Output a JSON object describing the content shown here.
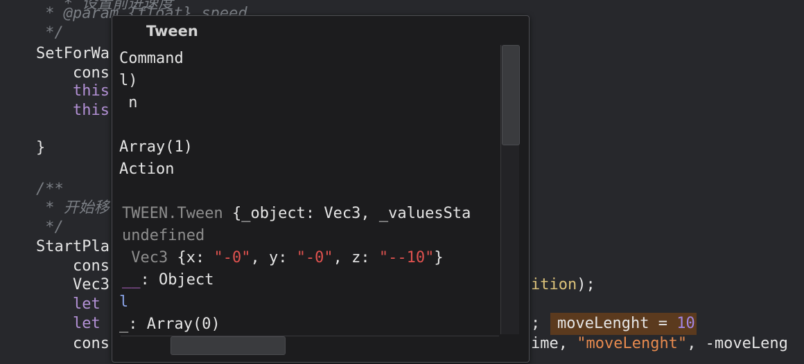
{
  "editor": {
    "lines": [
      {
        "id": "l0",
        "text": "   * 设置前进速度"
      },
      {
        "id": "l1",
        "text": " * @param {float} speed"
      },
      {
        "id": "l2",
        "text": " */"
      },
      {
        "id": "l3",
        "text": "SetForWa"
      },
      {
        "id": "l4",
        "text": "    cons"
      },
      {
        "id": "l5",
        "text": "    this"
      },
      {
        "id": "l6",
        "text": "    this"
      },
      {
        "id": "l7",
        "text": "}"
      },
      {
        "id": "l8",
        "text": "/**"
      },
      {
        "id": "l9",
        "text": " * 开始移"
      },
      {
        "id": "l10",
        "text": " */"
      },
      {
        "id": "l11",
        "text": "StartPla"
      },
      {
        "id": "l12",
        "text": "    cons"
      },
      {
        "id": "l13",
        "text": "    Vec3"
      },
      {
        "id": "l14",
        "text": "    let"
      },
      {
        "id": "l15",
        "text": "    let"
      },
      {
        "id": "l16",
        "text": "    cons"
      }
    ],
    "right_fragments": {
      "ition": "ition",
      "ition_tail": ");",
      "semicolon": ";",
      "move_var": "moveLenght",
      "equals": " = ",
      "move_val": "10",
      "ime": "ime, ",
      "move_str": "\"moveLenght\"",
      "tail": ", -moveLeng"
    }
  },
  "popup": {
    "title": "Tween",
    "lines": {
      "p0": "Command",
      "p1": "l)",
      "p2": " n",
      "p3": "Array(1)",
      "p4": "Action",
      "p5_a": "TWEEN.Tween ",
      "p5_b": "{_object: Vec3, _valuesSta",
      "p6": "undefined",
      "p7_a": " Vec3 ",
      "p7_b": "{x: ",
      "p7_c": "\"-0\"",
      "p7_d": ", y: ",
      "p7_e": "\"-0\"",
      "p7_f": ", z: ",
      "p7_g": "\"--10\"",
      "p7_h": "}",
      "p8_a": "__",
      "p8_b": ": Object",
      "p9": "l",
      "p10_a": "_",
      "p10_b": ": Array(0)"
    }
  }
}
